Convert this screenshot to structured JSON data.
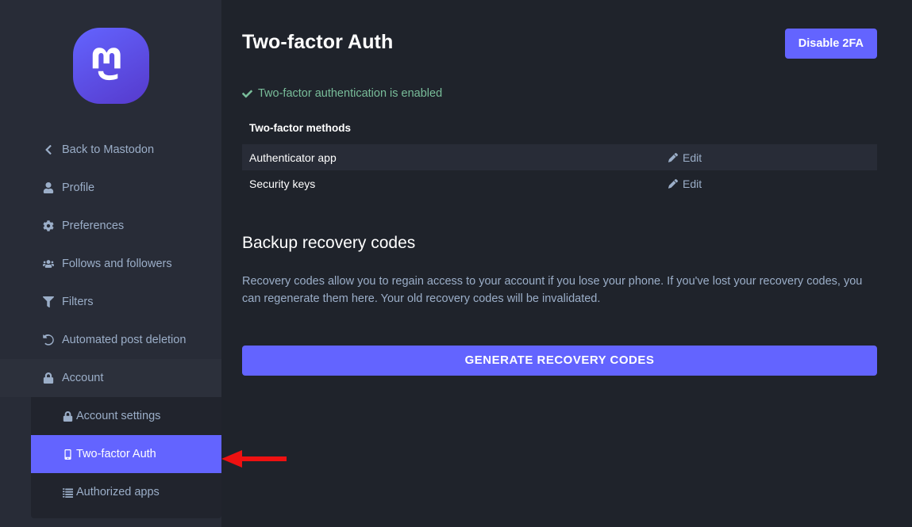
{
  "sidebar": {
    "logo_alt": "mastodon-logo",
    "items": [
      {
        "label": "Back to Mastodon",
        "icon": "chevron-left-icon"
      },
      {
        "label": "Profile",
        "icon": "user-icon"
      },
      {
        "label": "Preferences",
        "icon": "gear-icon"
      },
      {
        "label": "Follows and followers",
        "icon": "users-icon"
      },
      {
        "label": "Filters",
        "icon": "funnel-icon"
      },
      {
        "label": "Automated post deletion",
        "icon": "history-icon"
      }
    ],
    "account_group": {
      "label": "Account",
      "icon": "lock-icon"
    },
    "sub_items": [
      {
        "label": "Account settings",
        "icon": "lock-icon",
        "active": false
      },
      {
        "label": "Two-factor Auth",
        "icon": "mobile-icon",
        "active": true
      },
      {
        "label": "Authorized apps",
        "icon": "list-icon",
        "active": false
      }
    ]
  },
  "main": {
    "page_title": "Two-factor Auth",
    "disable_button": "Disable 2FA",
    "status_text": "Two-factor authentication is enabled",
    "status_icon": "check-icon",
    "table": {
      "header": "Two-factor methods",
      "rows": [
        {
          "name": "Authenticator app",
          "action": "Edit",
          "action_icon": "pencil-icon"
        },
        {
          "name": "Security keys",
          "action": "Edit",
          "action_icon": "pencil-icon"
        }
      ]
    },
    "recovery": {
      "title": "Backup recovery codes",
      "description": "Recovery codes allow you to regain access to your account if you lose your phone. If you've lost your recovery codes, you can regenerate them here. Your old recovery codes will be invalidated.",
      "generate_button": "GENERATE RECOVERY CODES"
    }
  },
  "annotation": {
    "arrow": "red-left-arrow",
    "color": "#ee1111"
  },
  "colors": {
    "accent": "#6364ff",
    "sidebar_bg": "#282c37",
    "main_bg": "#1f232b",
    "submenu_bg": "#21242d",
    "muted_text": "#9baec8",
    "success": "#79bd9a"
  }
}
